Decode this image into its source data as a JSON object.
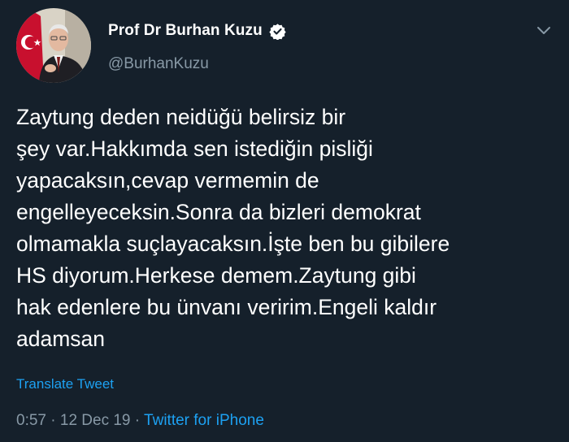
{
  "author": {
    "display_name": "Prof Dr Burhan Kuzu",
    "handle": "@BurhanKuzu",
    "verified": true,
    "avatar_icon": "profile-photo-with-turkish-flag"
  },
  "tweet": {
    "lines": [
      "Zaytung deden neidüğü belirsiz bir",
      "şey var.Hakkımda sen istediğin pisliği",
      "yapacaksın,cevap vermemin de",
      "engelleyeceksin.Sonra da bizleri demokrat",
      "olmamakla suçlayacaksın.İşte ben bu gibilere",
      "HS diyorum.Herkese demem.Zaytung gibi",
      "hak edenlere bu ünvanı veririm.Engeli kaldır",
      "adamsan"
    ],
    "translate_label": "Translate Tweet"
  },
  "meta": {
    "time": "0:57",
    "separator1": " · ",
    "date": "12 Dec 19",
    "separator2": " · ",
    "source": "Twitter for iPhone"
  },
  "colors": {
    "background": "#15202b",
    "text": "#ffffff",
    "secondary": "#8899a6",
    "accent": "#1da1f2"
  },
  "icons": {
    "verified": "verified-badge-icon",
    "menu": "chevron-down-icon"
  }
}
